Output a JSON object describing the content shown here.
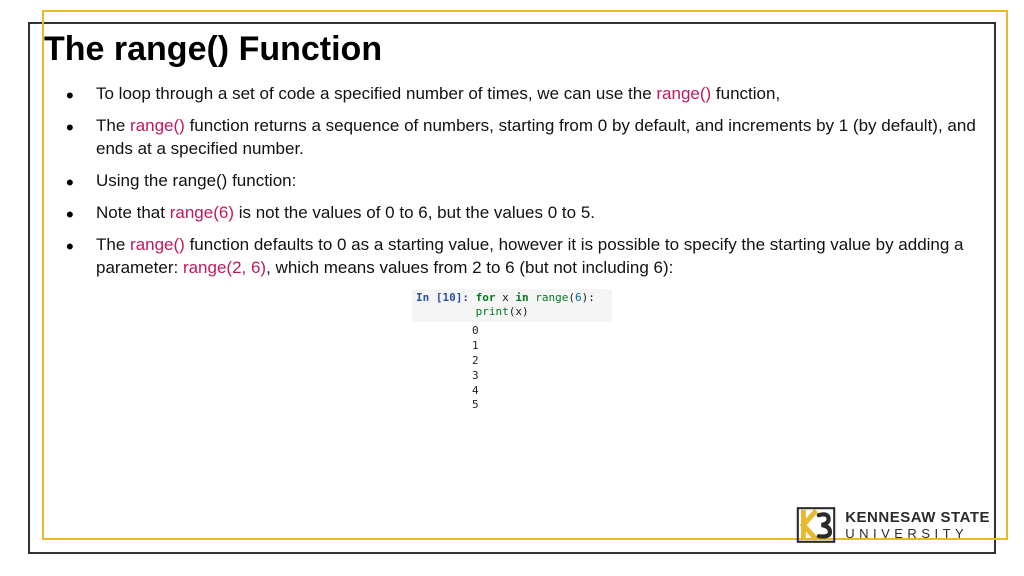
{
  "title": "The range() Function",
  "bullets": [
    {
      "pre": "To loop through a set of code a specified number of times, we can use the ",
      "h1": "range()",
      "post": " function,"
    },
    {
      "pre": "The ",
      "h1": "range()",
      "mid": " function returns a sequence of numbers, starting from 0 by default, and increments by 1 (by default), and ends at a specified number."
    },
    {
      "pre": "Using the range() function:"
    },
    {
      "pre": "Note that ",
      "h1": "range(6)",
      "mid": " is not the values of 0 to 6, but the values 0 to 5."
    },
    {
      "pre": "The ",
      "h1": "range()",
      "mid": " function defaults to 0 as a starting value, however it is possible to specify the starting value by adding a parameter: ",
      "h2": "range(2, 6)",
      "post": ", which means values from 2 to 6 (but not including 6):"
    }
  ],
  "code": {
    "in_label": "In [10]:",
    "kw_for": "for",
    "var": " x ",
    "kw_in": "in",
    "fn": " range",
    "open": "(",
    "arg": "6",
    "close": "):",
    "indent": "         ",
    "print": "print",
    "popen": "(x)",
    "output": "0\n1\n2\n3\n4\n5"
  },
  "logo": {
    "line1": "KENNESAW STATE",
    "line2": "UNIVERSITY"
  }
}
